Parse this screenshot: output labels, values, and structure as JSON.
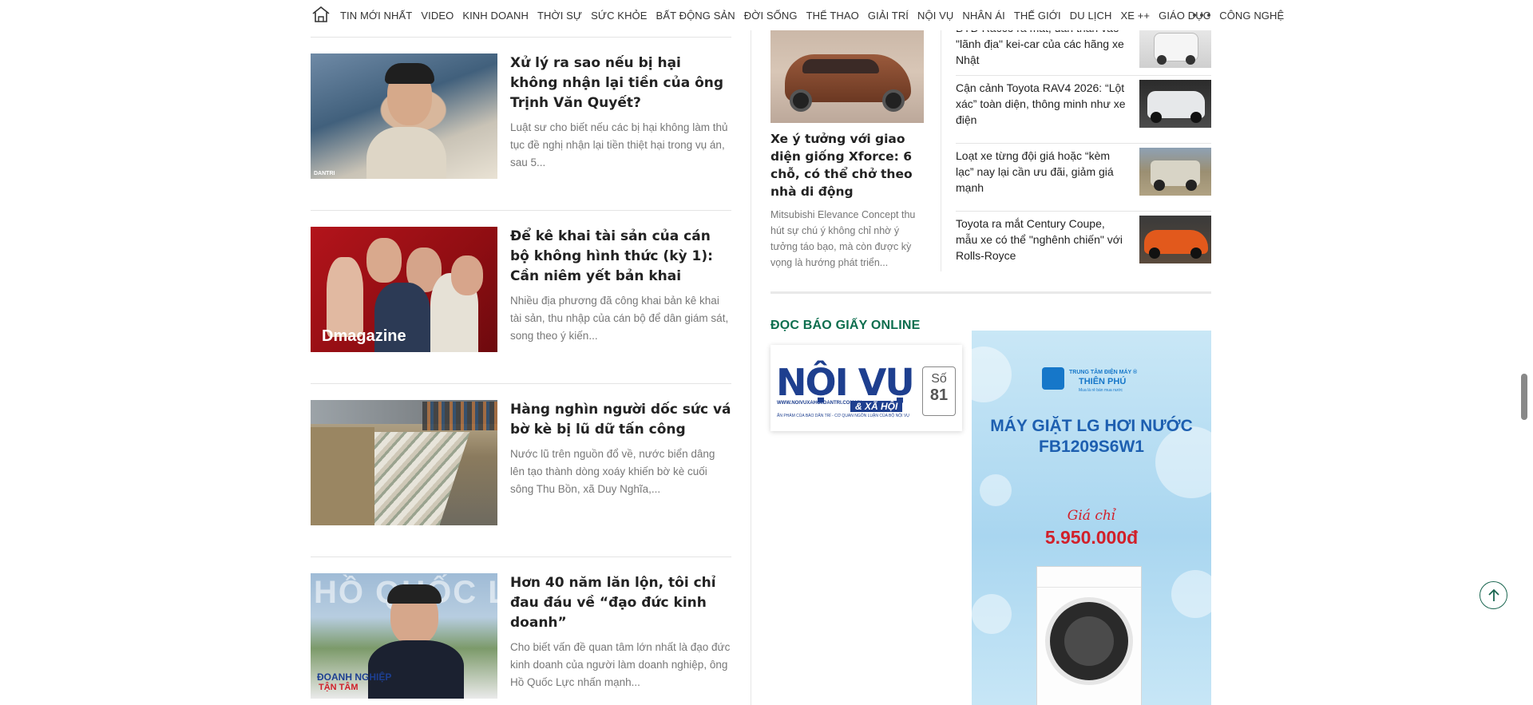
{
  "nav": {
    "items": [
      "TIN MỚI NHẤT",
      "VIDEO",
      "KINH DOANH",
      "THỜI SỰ",
      "SỨC KHỎE",
      "BẤT ĐỘNG SẢN",
      "ĐỜI SỐNG",
      "THỂ THAO",
      "GIẢI TRÍ",
      "NỘI VỤ",
      "NHÂN ÁI",
      "THẾ GIỚI",
      "DU LỊCH",
      "XE ++",
      "GIÁO DỤC",
      "CÔNG NGHỆ"
    ]
  },
  "articles": [
    {
      "title": "Xử lý ra sao nếu bị hại không nhận lại tiền của ông Trịnh Văn Quyết?",
      "summary": "Luật sư cho biết nếu các bị hại không làm thủ tục đề nghị nhận lại tiền thiệt hại trong vụ án, sau 5...",
      "badge": "DANTRI"
    },
    {
      "title": "Để kê khai tài sản của cán bộ không hình thức (kỳ 1): Cần niêm yết bản khai",
      "summary": "Nhiều địa phương đã công khai bản kê khai tài sản, thu nhập của cán bộ để dân giám sát, song theo ý kiến...",
      "badge": "Dmagazine"
    },
    {
      "title": "Hàng nghìn người dốc sức vá bờ kè bị lũ dữ tấn công",
      "summary": "Nước lũ trên nguồn đổ về, nước biển dâng lên tạo thành dòng xoáy khiến bờ kè cuối sông Thu Bồn, xã Duy Nghĩa,...",
      "badge": ""
    },
    {
      "title": "Hơn 40 năm lăn lộn, tôi chỉ đau đáu về “đạo đức kinh doanh”",
      "summary": "Cho biết vấn đề quan tâm lớn nhất là đạo đức kinh doanh của người làm doanh nghiệp, ông Hồ Quốc Lực nhấn mạnh...",
      "badge": "HỒ QUỐC LỰC"
    }
  ],
  "feature": {
    "title": "Xe ý tưởng với giao diện giống Xforce: 6 chỗ, có thể chở theo nhà di động",
    "summary": "Mitsubishi Elevance Concept thu hút sự chú ý không chỉ nhờ ý tưởng táo bạo, mà còn được kỳ vọng là hướng phát triển..."
  },
  "small_items": [
    {
      "title": "BYD Racco ra mắt, dấn thân vào \"lãnh địa\" kei-car của các hãng xe Nhật"
    },
    {
      "title": "Cận cảnh Toyota RAV4 2026: “Lột xác” toàn diện, thông minh như xe điện"
    },
    {
      "title": "Loạt xe từng đội giá hoặc “kèm lạc” nay lại cần ưu đãi, giảm giá mạnh"
    },
    {
      "title": "Toyota ra mắt Century Coupe, mẫu xe có thể \"nghênh chiến\" với Rolls-Royce"
    }
  ],
  "section": {
    "title": "ĐỌC BÁO GIẤY ONLINE"
  },
  "paper": {
    "logo": "NỘI VỤ",
    "sublogo": "& XÃ HỘI",
    "url": "WWW.NOIVUXAHOI.DANTRI.COM.VN",
    "tagline": "ẤN PHẨM CỦA BÁO DÂN TRÍ - CƠ QUAN NGÔN LUẬN CỦA BỘ NỘI VỤ",
    "issue_label": "Số",
    "issue_number": "81"
  },
  "ad": {
    "brand_line1": "TRUNG TÂM ĐIỆN MÁY ®",
    "brand_line2": "THIÊN PHÚ",
    "brand_line3": "Mua là rẻ bán mua nước",
    "headline1": "MÁY GIẶT LG HƠI NƯỚC",
    "headline2": "FB1209S6W1",
    "price_label": "Giá chỉ",
    "price": "5.950.000đ"
  },
  "colors": {
    "accent": "#0d6e4e",
    "price": "#d1202a",
    "ad_blue": "#1d5fb0"
  }
}
